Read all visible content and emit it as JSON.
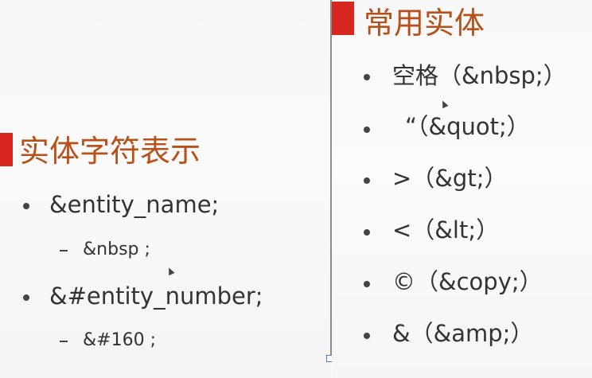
{
  "left_panel": {
    "heading": "实体字符表示",
    "items": [
      {
        "text": "&entity_name;",
        "sub": "&nbsp ;"
      },
      {
        "text": "&#entity_number;",
        "sub": "&#160 ;"
      }
    ]
  },
  "right_panel": {
    "heading": "常用实体",
    "items": [
      "空格（&nbsp;）",
      "“（&quot;）",
      ">（&gt;）",
      "<（&lt;）",
      "©（&copy;）",
      "&（&amp;）"
    ]
  },
  "colors": {
    "accent": "#d7261e",
    "heading": "#b8501a",
    "text": "#333333"
  }
}
